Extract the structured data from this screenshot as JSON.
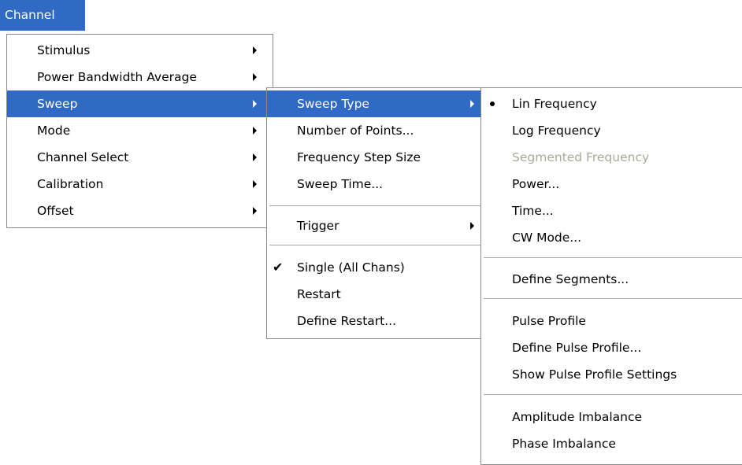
{
  "menubar": {
    "title": "Channel"
  },
  "channel_menu": {
    "items": [
      {
        "label": "Stimulus"
      },
      {
        "label": "Power Bandwidth Average"
      },
      {
        "label": "Sweep"
      },
      {
        "label": "Mode"
      },
      {
        "label": "Channel Select"
      },
      {
        "label": "Calibration"
      },
      {
        "label": "Offset"
      }
    ]
  },
  "sweep_menu": {
    "sweep_type": "Sweep Type",
    "number_of_points": "Number of Points...",
    "frequency_step_size": "Frequency Step Size",
    "sweep_time": "Sweep Time...",
    "trigger": "Trigger",
    "single_all_chans": "Single (All Chans)",
    "restart": "Restart",
    "define_restart": "Define Restart..."
  },
  "sweep_type_menu": {
    "lin_frequency": "Lin Frequency",
    "log_frequency": "Log Frequency",
    "segmented_frequency": "Segmented Frequency",
    "power": "Power...",
    "time": "Time...",
    "cw_mode": "CW Mode...",
    "define_segments": "Define Segments...",
    "pulse_profile": "Pulse Profile",
    "define_pulse_profile": "Define Pulse Profile...",
    "show_pulse_profile_settings": "Show Pulse Profile Settings",
    "amplitude_imbalance": "Amplitude Imbalance",
    "phase_imbalance": "Phase Imbalance"
  },
  "colors": {
    "highlight": "#316ac5",
    "disabled_text": "#aca899",
    "menu_border": "#8c8c8c"
  },
  "icons": {
    "submenu": "triangle-right-icon",
    "checked": "checkmark-icon",
    "selected_radio": "bullet-icon"
  }
}
